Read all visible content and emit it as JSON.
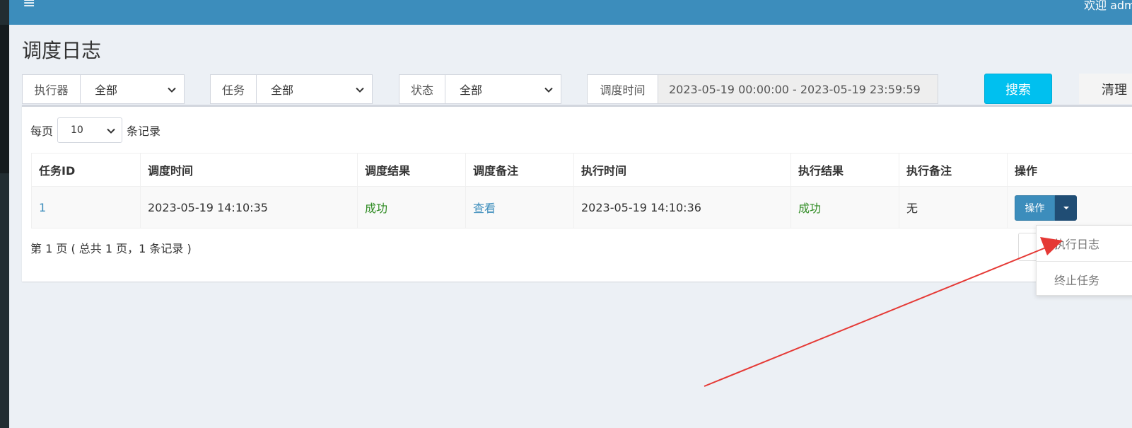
{
  "header": {
    "welcome_text": "欢迎 admin"
  },
  "page": {
    "title": "调度日志"
  },
  "filters": {
    "executor": {
      "label": "执行器",
      "value": "全部"
    },
    "task": {
      "label": "任务",
      "value": "全部"
    },
    "status": {
      "label": "状态",
      "value": "全部"
    },
    "time": {
      "label": "调度时间",
      "value": "2023-05-19 00:00:00 - 2023-05-19 23:59:59"
    },
    "search_label": "搜索",
    "clear_label": "清理"
  },
  "perpage": {
    "prefix": "每页",
    "value": "10",
    "suffix": "条记录"
  },
  "table": {
    "headers": [
      "任务ID",
      "调度时间",
      "调度结果",
      "调度备注",
      "执行时间",
      "执行结果",
      "执行备注",
      "操作"
    ],
    "rows": [
      {
        "task_id": "1",
        "trigger_time": "2023-05-19 14:10:35",
        "trigger_result": "成功",
        "trigger_note": "查看",
        "handle_time": "2023-05-19 14:10:36",
        "handle_result": "成功",
        "handle_note": "无",
        "action_label": "操作"
      }
    ]
  },
  "pager": {
    "info": "第 1 页 ( 总共 1 页，1 条记录 )"
  },
  "dropdown": {
    "items": [
      "执行日志",
      "终止任务"
    ]
  },
  "colors": {
    "topbar": "#3c8dbc",
    "search_button": "#00c0ef",
    "success": "#00a65a",
    "annotation_arrow": "#e53935"
  },
  "icons": {
    "menu": "hamburger-icon",
    "select": "chevron-down-icon",
    "caret": "caret-down-icon"
  }
}
